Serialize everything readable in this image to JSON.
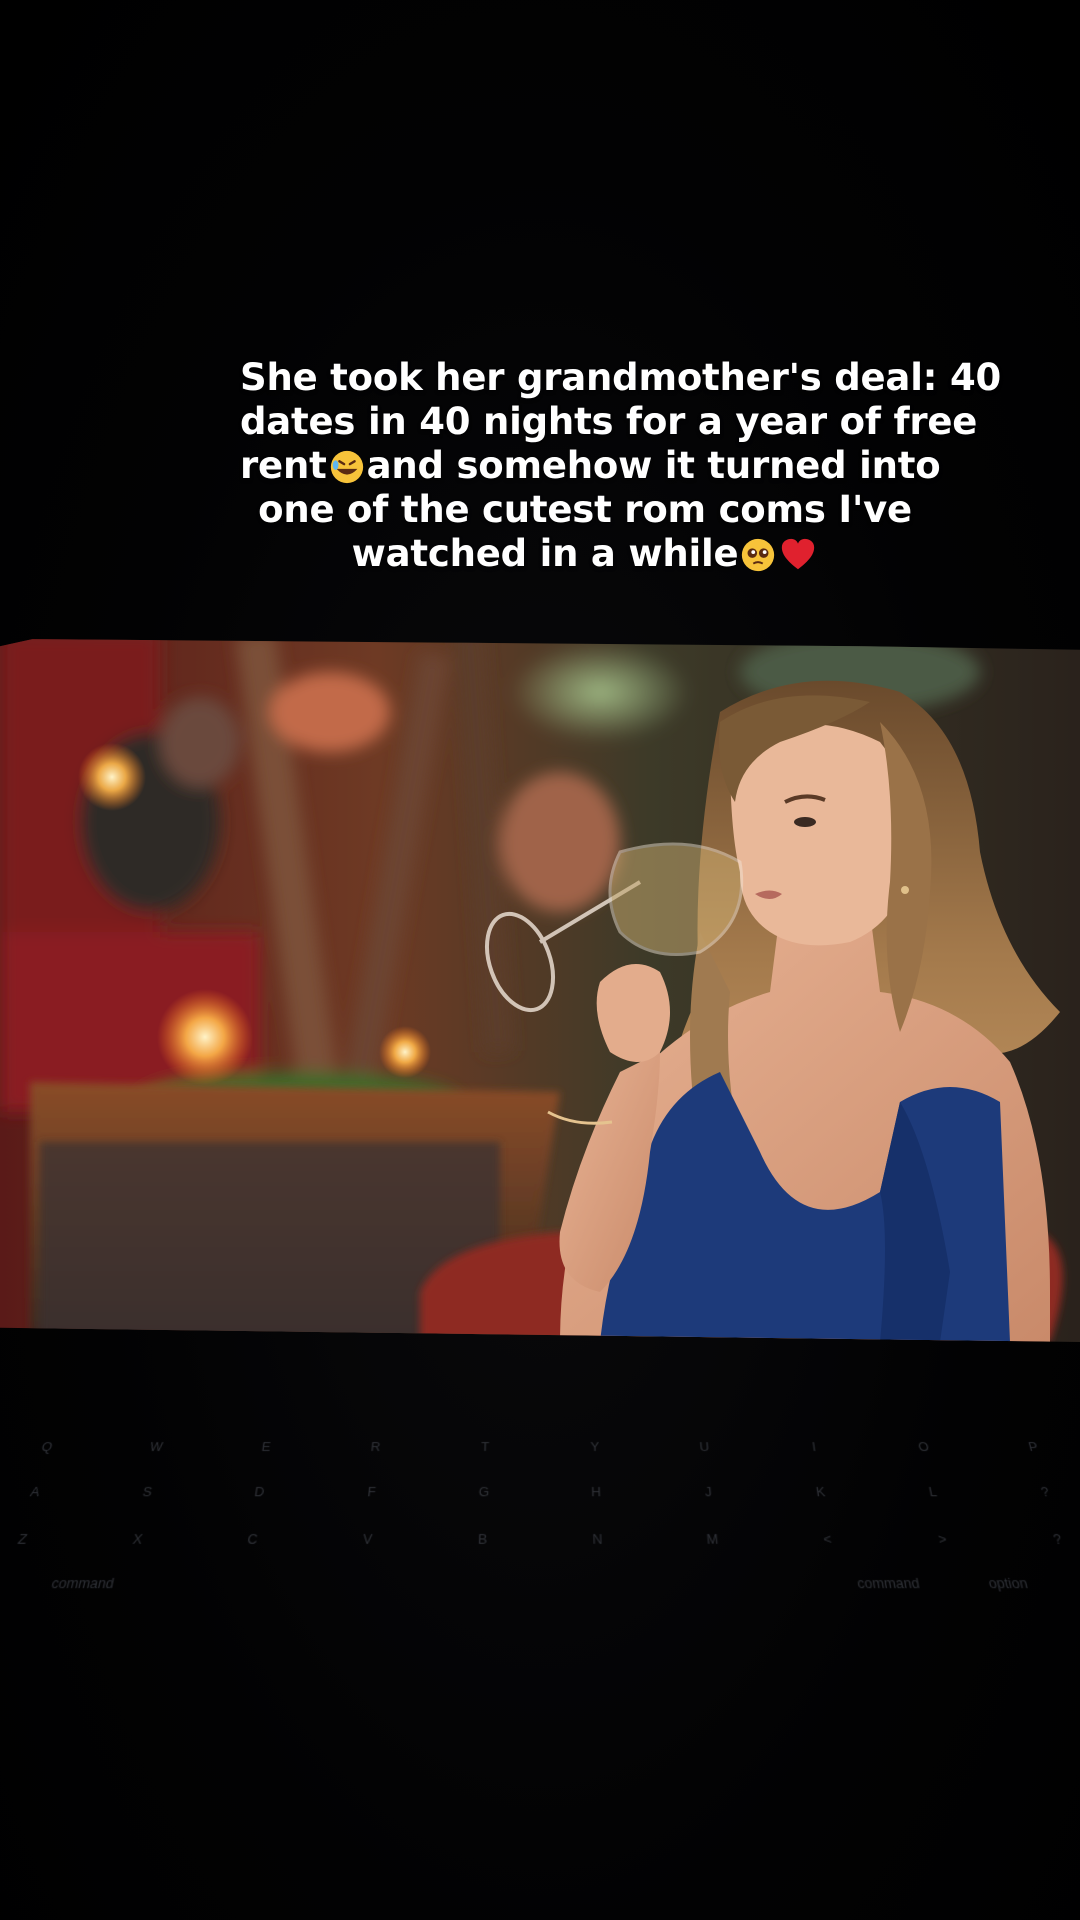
{
  "caption": {
    "line1": "She took her grandmother's deal: 40",
    "line2": "dates in 40 nights for a year of free",
    "line3_a": "rent",
    "line3_b": "and somehow it turned into",
    "line4": "one of the cutest rom coms I've",
    "line5": "watched in a while"
  },
  "emojis": {
    "laughing": "rolling-on-floor-laughing-icon",
    "pleading": "pleading-face-icon",
    "heart": "red-heart-icon"
  },
  "keyboard": {
    "row1": [
      "Q",
      "W",
      "E",
      "R",
      "T",
      "Y",
      "U",
      "I",
      "O",
      "P"
    ],
    "row2": [
      "A",
      "S",
      "D",
      "F",
      "G",
      "H",
      "J",
      "K",
      "L",
      "?"
    ],
    "row3": [
      "Z",
      "X",
      "C",
      "V",
      "B",
      "N",
      "M",
      "<",
      ">",
      "?"
    ],
    "row4": [
      "command",
      "command",
      "option"
    ]
  },
  "colors": {
    "background": "#000000",
    "caption_text": "#ffffff",
    "dress": "#1d3a7a"
  }
}
